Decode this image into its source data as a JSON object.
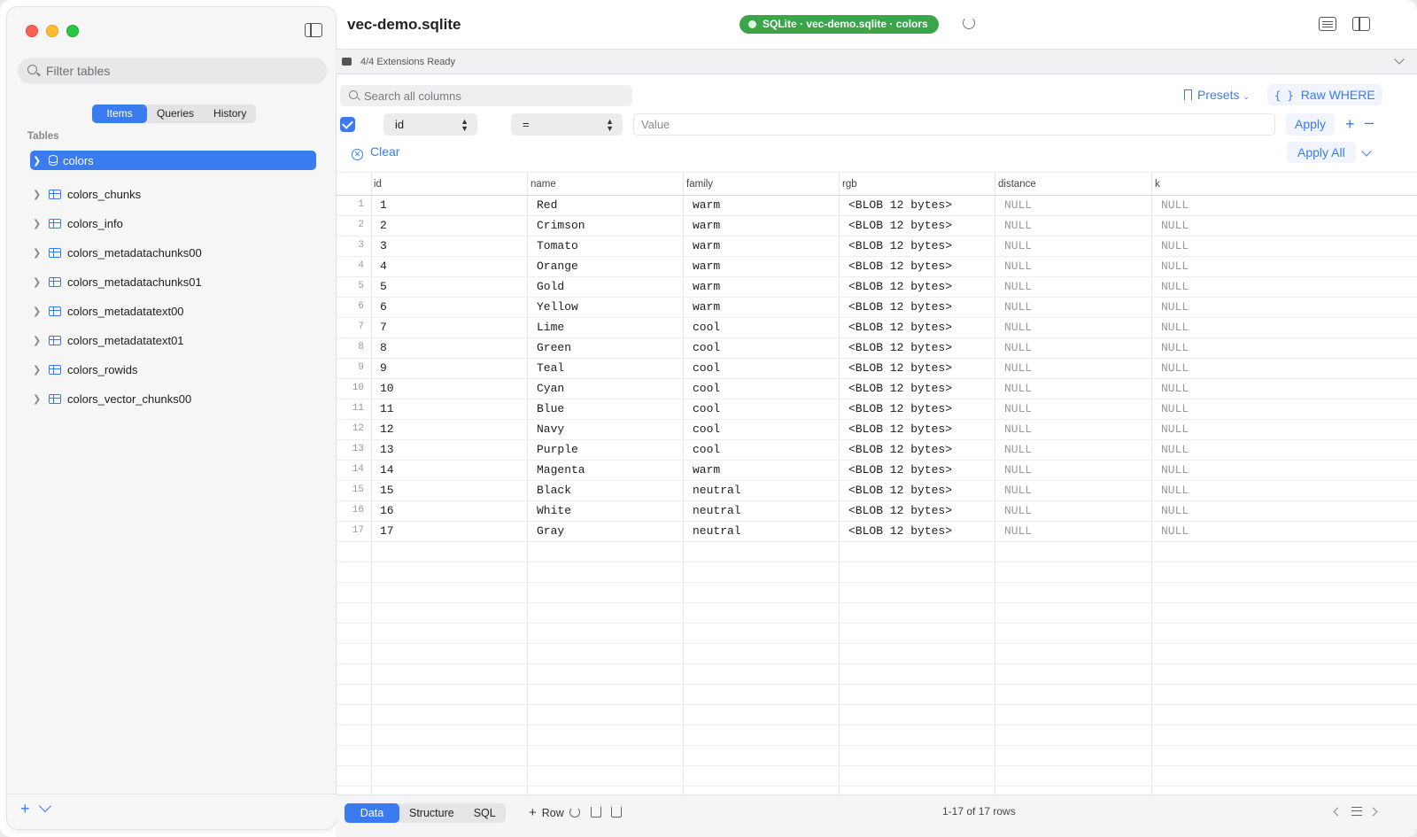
{
  "window": {
    "title": "vec-demo.sqlite"
  },
  "connection_badge": "SQLite · vec-demo.sqlite · colors",
  "sidebar": {
    "filter_placeholder": "Filter tables",
    "tabs": [
      "Items",
      "Queries",
      "History"
    ],
    "active_tab": "Items",
    "section_label": "Tables",
    "tables": [
      "colors",
      "colors_chunks",
      "colors_info",
      "colors_metadatachunks00",
      "colors_metadatachunks01",
      "colors_metadatatext00",
      "colors_metadatatext01",
      "colors_rowids",
      "colors_vector_chunks00"
    ],
    "selected_table": "colors"
  },
  "extensions": {
    "status": "4/4 Extensions Ready"
  },
  "filter_bar": {
    "search_placeholder": "Search all columns",
    "presets_label": "Presets",
    "raw_where_label": "Raw WHERE",
    "column": "id",
    "operator": "=",
    "value_placeholder": "Value",
    "apply_label": "Apply",
    "clear_label": "Clear",
    "apply_all_label": "Apply All",
    "enabled": true
  },
  "grid": {
    "columns": [
      "id",
      "name",
      "family",
      "rgb",
      "distance",
      "k"
    ],
    "rows": [
      {
        "n": "1",
        "id": "1",
        "name": "Red",
        "family": "warm",
        "rgb": "<BLOB 12 bytes>",
        "distance": "NULL",
        "k": "NULL"
      },
      {
        "n": "2",
        "id": "2",
        "name": "Crimson",
        "family": "warm",
        "rgb": "<BLOB 12 bytes>",
        "distance": "NULL",
        "k": "NULL"
      },
      {
        "n": "3",
        "id": "3",
        "name": "Tomato",
        "family": "warm",
        "rgb": "<BLOB 12 bytes>",
        "distance": "NULL",
        "k": "NULL"
      },
      {
        "n": "4",
        "id": "4",
        "name": "Orange",
        "family": "warm",
        "rgb": "<BLOB 12 bytes>",
        "distance": "NULL",
        "k": "NULL"
      },
      {
        "n": "5",
        "id": "5",
        "name": "Gold",
        "family": "warm",
        "rgb": "<BLOB 12 bytes>",
        "distance": "NULL",
        "k": "NULL"
      },
      {
        "n": "6",
        "id": "6",
        "name": "Yellow",
        "family": "warm",
        "rgb": "<BLOB 12 bytes>",
        "distance": "NULL",
        "k": "NULL"
      },
      {
        "n": "7",
        "id": "7",
        "name": "Lime",
        "family": "cool",
        "rgb": "<BLOB 12 bytes>",
        "distance": "NULL",
        "k": "NULL"
      },
      {
        "n": "8",
        "id": "8",
        "name": "Green",
        "family": "cool",
        "rgb": "<BLOB 12 bytes>",
        "distance": "NULL",
        "k": "NULL"
      },
      {
        "n": "9",
        "id": "9",
        "name": "Teal",
        "family": "cool",
        "rgb": "<BLOB 12 bytes>",
        "distance": "NULL",
        "k": "NULL"
      },
      {
        "n": "10",
        "id": "10",
        "name": "Cyan",
        "family": "cool",
        "rgb": "<BLOB 12 bytes>",
        "distance": "NULL",
        "k": "NULL"
      },
      {
        "n": "11",
        "id": "11",
        "name": "Blue",
        "family": "cool",
        "rgb": "<BLOB 12 bytes>",
        "distance": "NULL",
        "k": "NULL"
      },
      {
        "n": "12",
        "id": "12",
        "name": "Navy",
        "family": "cool",
        "rgb": "<BLOB 12 bytes>",
        "distance": "NULL",
        "k": "NULL"
      },
      {
        "n": "13",
        "id": "13",
        "name": "Purple",
        "family": "cool",
        "rgb": "<BLOB 12 bytes>",
        "distance": "NULL",
        "k": "NULL"
      },
      {
        "n": "14",
        "id": "14",
        "name": "Magenta",
        "family": "warm",
        "rgb": "<BLOB 12 bytes>",
        "distance": "NULL",
        "k": "NULL"
      },
      {
        "n": "15",
        "id": "15",
        "name": "Black",
        "family": "neutral",
        "rgb": "<BLOB 12 bytes>",
        "distance": "NULL",
        "k": "NULL"
      },
      {
        "n": "16",
        "id": "16",
        "name": "White",
        "family": "neutral",
        "rgb": "<BLOB 12 bytes>",
        "distance": "NULL",
        "k": "NULL"
      },
      {
        "n": "17",
        "id": "17",
        "name": "Gray",
        "family": "neutral",
        "rgb": "<BLOB 12 bytes>",
        "distance": "NULL",
        "k": "NULL"
      }
    ]
  },
  "bottom_bar": {
    "tabs": [
      "Data",
      "Structure",
      "SQL"
    ],
    "active_tab": "Data",
    "add_row_label": "Row",
    "row_count": "1-17 of 17 rows"
  },
  "colors": {
    "accent": "#3a7bf0",
    "badge_green": "#3aa54a"
  }
}
